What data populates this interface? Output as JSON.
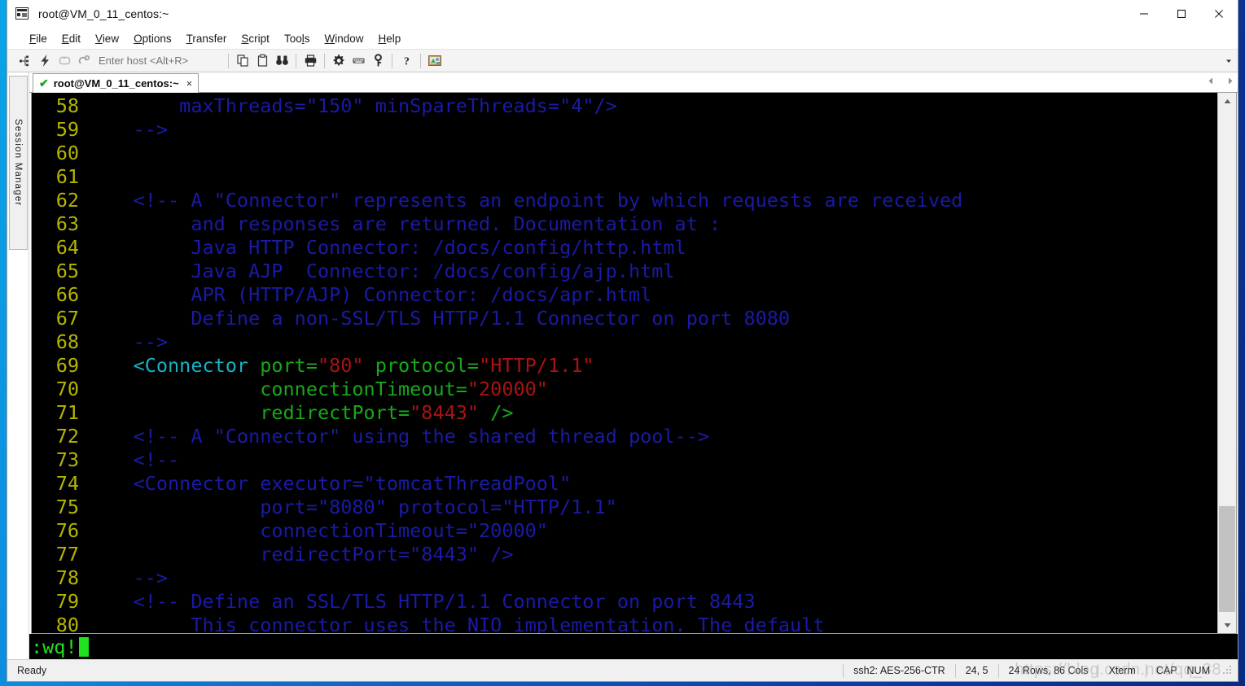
{
  "window": {
    "title": "root@VM_0_11_centos:~",
    "icon": "terminal-app-icon",
    "controls": {
      "minimize": "minimize",
      "maximize": "maximize",
      "close": "close"
    }
  },
  "menubar": {
    "items": [
      {
        "label": "File",
        "accel": "F"
      },
      {
        "label": "Edit",
        "accel": "E"
      },
      {
        "label": "View",
        "accel": "V"
      },
      {
        "label": "Options",
        "accel": "O"
      },
      {
        "label": "Transfer",
        "accel": "T"
      },
      {
        "label": "Script",
        "accel": "S"
      },
      {
        "label": "Tools",
        "accel": "l"
      },
      {
        "label": "Window",
        "accel": "W"
      },
      {
        "label": "Help",
        "accel": "H"
      }
    ]
  },
  "toolbar": {
    "buttons": [
      {
        "name": "connect-icon",
        "glyph": "connect"
      },
      {
        "name": "quick-connect-icon",
        "glyph": "lightning"
      },
      {
        "name": "reconnect-icon",
        "glyph": "loop"
      },
      {
        "name": "disconnect-icon",
        "glyph": "disconnect"
      }
    ],
    "host_placeholder": "Enter host <Alt+R>",
    "host_value": "",
    "buttons2": [
      {
        "name": "copy-icon",
        "glyph": "copy"
      },
      {
        "name": "paste-icon",
        "glyph": "paste"
      },
      {
        "name": "find-icon",
        "glyph": "binoculars"
      }
    ],
    "buttons3": [
      {
        "name": "print-icon",
        "glyph": "printer"
      }
    ],
    "buttons4": [
      {
        "name": "settings-icon",
        "glyph": "gear"
      },
      {
        "name": "keyboard-icon",
        "glyph": "keyboard"
      },
      {
        "name": "key-icon",
        "glyph": "key"
      }
    ],
    "buttons5": [
      {
        "name": "help-icon",
        "glyph": "question"
      }
    ],
    "buttons6": [
      {
        "name": "ssh-session-icon",
        "glyph": "ssh-color"
      }
    ],
    "overflow": "▾"
  },
  "sidebar": {
    "session_manager_label": "Session Manager"
  },
  "tabbar": {
    "tab_label": "root@VM_0_11_centos:~",
    "tab_status": "✔",
    "close_glyph": "×",
    "nav_prev": "◀",
    "nav_next": "▶"
  },
  "terminal": {
    "lines": [
      {
        "num": "58",
        "parts": [
          {
            "t": "        maxThreads=\"150\" minSpareThreads=\"4\"/>",
            "c": "c-com"
          }
        ]
      },
      {
        "num": "59",
        "parts": [
          {
            "t": "    -->",
            "c": "c-com"
          }
        ]
      },
      {
        "num": "60",
        "parts": [
          {
            "t": "",
            "c": "c-plain"
          }
        ]
      },
      {
        "num": "61",
        "parts": [
          {
            "t": "",
            "c": "c-plain"
          }
        ]
      },
      {
        "num": "62",
        "parts": [
          {
            "t": "    <!-- A \"Connector\" represents an endpoint by which requests are received",
            "c": "c-com"
          }
        ]
      },
      {
        "num": "63",
        "parts": [
          {
            "t": "         and responses are returned. Documentation at :",
            "c": "c-com"
          }
        ]
      },
      {
        "num": "64",
        "parts": [
          {
            "t": "         Java HTTP Connector: /docs/config/http.html",
            "c": "c-com"
          }
        ]
      },
      {
        "num": "65",
        "parts": [
          {
            "t": "         Java AJP  Connector: /docs/config/ajp.html",
            "c": "c-com"
          }
        ]
      },
      {
        "num": "66",
        "parts": [
          {
            "t": "         APR (HTTP/AJP) Connector: /docs/apr.html",
            "c": "c-com"
          }
        ]
      },
      {
        "num": "67",
        "parts": [
          {
            "t": "         Define a non-SSL/TLS HTTP/1.1 Connector on port 8080",
            "c": "c-com"
          }
        ]
      },
      {
        "num": "68",
        "parts": [
          {
            "t": "    -->",
            "c": "c-com"
          }
        ]
      },
      {
        "num": "69",
        "parts": [
          {
            "t": "    <Connector ",
            "c": "c-tag"
          },
          {
            "t": "port=",
            "c": "c-attr"
          },
          {
            "t": "\"80\"",
            "c": "c-val"
          },
          {
            "t": " protocol=",
            "c": "c-attr"
          },
          {
            "t": "\"HTTP/1.1\"",
            "c": "c-val"
          }
        ]
      },
      {
        "num": "70",
        "parts": [
          {
            "t": "               connectionTimeout=",
            "c": "c-attr"
          },
          {
            "t": "\"20000\"",
            "c": "c-val"
          }
        ]
      },
      {
        "num": "71",
        "parts": [
          {
            "t": "               redirectPort=",
            "c": "c-attr"
          },
          {
            "t": "\"8443\"",
            "c": "c-val"
          },
          {
            "t": " />",
            "c": "c-attr"
          }
        ]
      },
      {
        "num": "72",
        "parts": [
          {
            "t": "    <!-- A \"Connector\" using the shared thread pool-->",
            "c": "c-com"
          }
        ]
      },
      {
        "num": "73",
        "parts": [
          {
            "t": "    <!--",
            "c": "c-com"
          }
        ]
      },
      {
        "num": "74",
        "parts": [
          {
            "t": "    <Connector executor=\"tomcatThreadPool\"",
            "c": "c-com"
          }
        ]
      },
      {
        "num": "75",
        "parts": [
          {
            "t": "               port=\"8080\" protocol=\"HTTP/1.1\"",
            "c": "c-com"
          }
        ]
      },
      {
        "num": "76",
        "parts": [
          {
            "t": "               connectionTimeout=\"20000\"",
            "c": "c-com"
          }
        ]
      },
      {
        "num": "77",
        "parts": [
          {
            "t": "               redirectPort=\"8443\" />",
            "c": "c-com"
          }
        ]
      },
      {
        "num": "78",
        "parts": [
          {
            "t": "    -->",
            "c": "c-com"
          }
        ]
      },
      {
        "num": "79",
        "parts": [
          {
            "t": "    <!-- Define an SSL/TLS HTTP/1.1 Connector on port 8443",
            "c": "c-com"
          }
        ]
      },
      {
        "num": "80",
        "parts": [
          {
            "t": "         This connector uses the NIO implementation. The default",
            "c": "c-com"
          }
        ]
      }
    ],
    "command_line": ":wq!"
  },
  "statusbar": {
    "ready": "Ready",
    "encryption": "ssh2: AES-256-CTR",
    "cursor_pos": "24,  5",
    "dimensions": "24 Rows, 86 Cols",
    "emulation": "Xterm",
    "caps": "CAP",
    "num": "NUM"
  },
  "watermark": "https://blog.csdn.net/qq_38",
  "colors": {
    "terminal_bg": "#000000",
    "line_number": "#b5b500",
    "comment": "#1a1aa6",
    "tag": "#17b2c4",
    "attribute": "#17a81a",
    "value": "#a61414",
    "vim_command": "#20e020",
    "desktop": "#0a5fb4"
  }
}
